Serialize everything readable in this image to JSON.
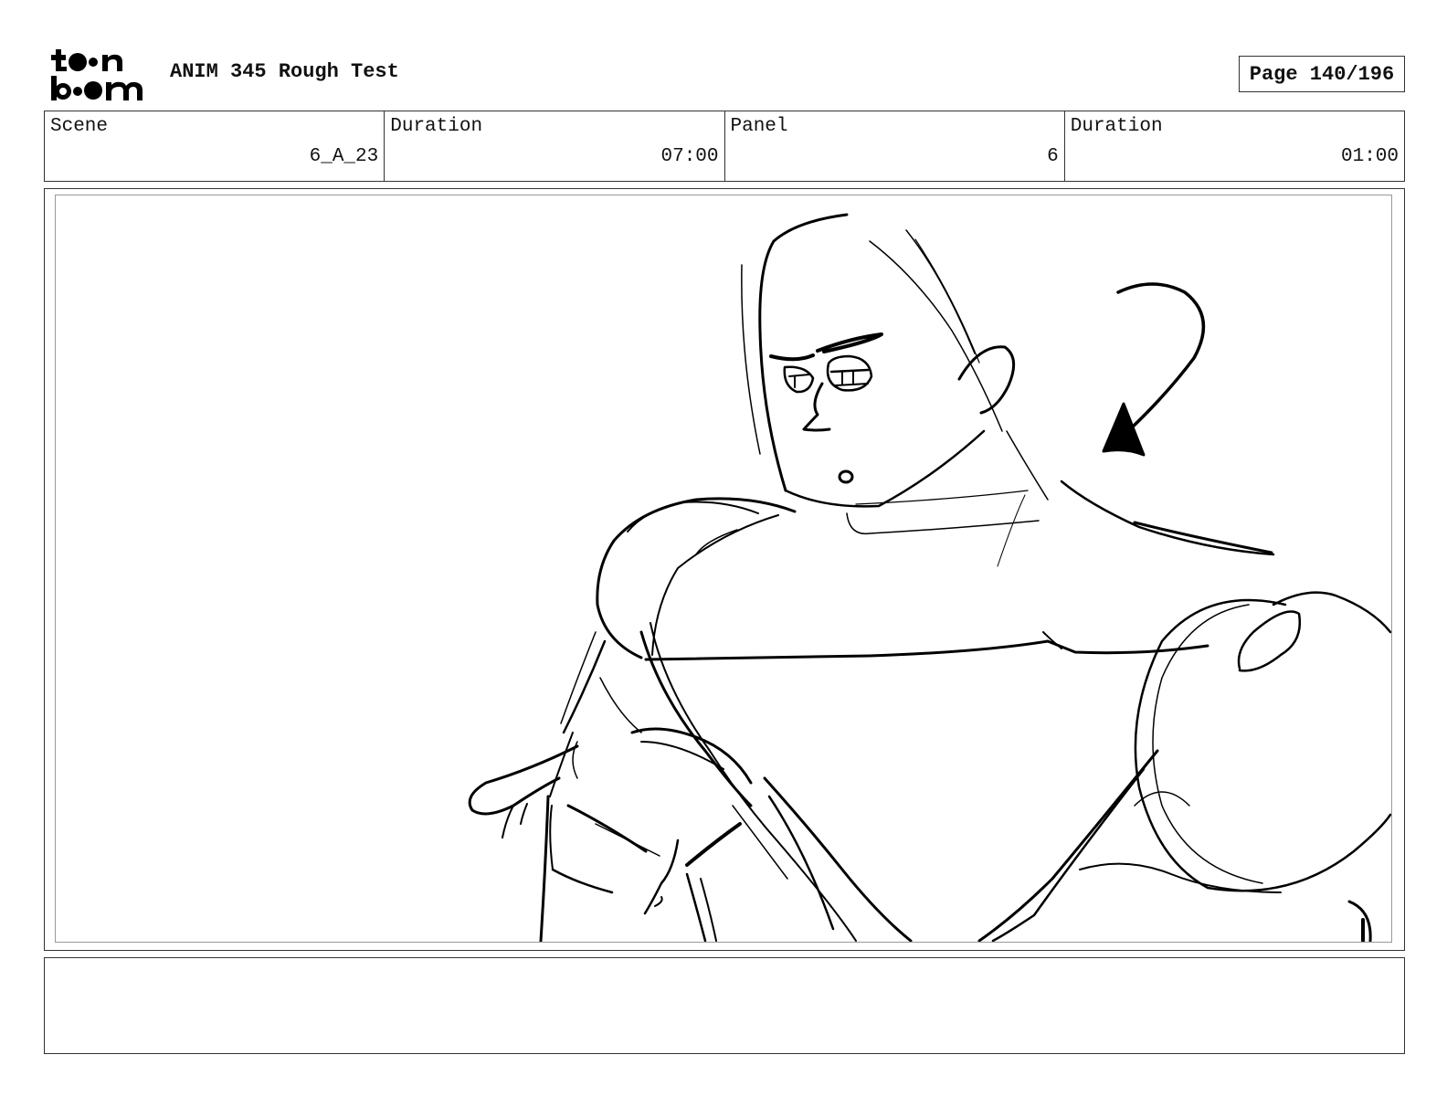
{
  "header": {
    "logo_text_top": "toon",
    "logo_text_bottom": "boom",
    "title": "ANIM 345 Rough Test",
    "page": "Page 140/196"
  },
  "info": {
    "scene_label": "Scene",
    "scene_value": "6_A_23",
    "duration_label": "Duration",
    "duration_value": "07:00",
    "panel_label": "Panel",
    "panel_value": "6",
    "panel_duration_label": "Duration",
    "panel_duration_value": "01:00"
  },
  "notes": {
    "text": ""
  }
}
